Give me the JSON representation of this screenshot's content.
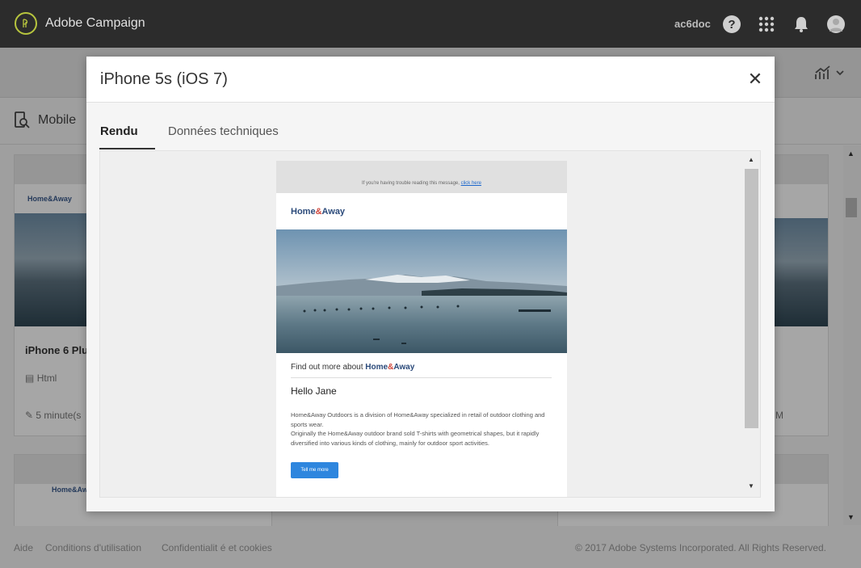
{
  "header": {
    "brand": "Adobe Campaign",
    "username": "ac6doc",
    "help_glyph": "?"
  },
  "page": {
    "title": "Mobile"
  },
  "cards": [
    {
      "logo": "Home&Away",
      "name": "iPhone 6 Plu",
      "type": "Html",
      "time": "5 minute(s"
    },
    {
      "time_suffix": "M"
    }
  ],
  "footer": {
    "help": "Aide",
    "terms": "Conditions d'utilisation",
    "privacy": "Confidentialit é  et cookies",
    "copyright": "© 2017 Adobe Systems Incorporated. All Rights Reserved."
  },
  "modal": {
    "title": "iPhone 5s (iOS 7)",
    "close_glyph": "✕",
    "tabs": [
      {
        "label": "Rendu",
        "active": true
      },
      {
        "label": "Données techniques",
        "active": false
      }
    ]
  },
  "email": {
    "trouble_text": "If you're having trouble reading this message, ",
    "trouble_link": "click here",
    "logo_home": "Home",
    "logo_amp": "&",
    "logo_away": "Away",
    "findout_prefix": "Find out more about ",
    "findout_brand_home": "Home",
    "findout_brand_amp": "&",
    "findout_brand_away": "Away",
    "greeting": "Hello Jane",
    "paragraph_1": "Home&Away Outdoors is a division of Home&Away specialized in retail of outdoor clothing and sports wear.",
    "paragraph_2": "Originally the Home&Away outdoor brand sold T-shirts with geometrical shapes, but it rapidly diversified into various kinds of clothing, mainly for outdoor sport activities.",
    "button_label": "Tell me more"
  },
  "colors": {
    "header_bg": "#2c2c2c",
    "logo_accent": "#b7c53e",
    "brand_blue": "#2b4a7a",
    "brand_red": "#d0463b",
    "button_blue": "#2e86de"
  },
  "icons": {
    "logo": "adobe-campaign-logo",
    "help": "help-icon",
    "apps": "apps-grid-icon",
    "notifications": "bell-icon",
    "avatar": "avatar-icon",
    "analytics": "analytics-chart-icon",
    "page": "mobile-search-icon",
    "close": "close-icon"
  }
}
